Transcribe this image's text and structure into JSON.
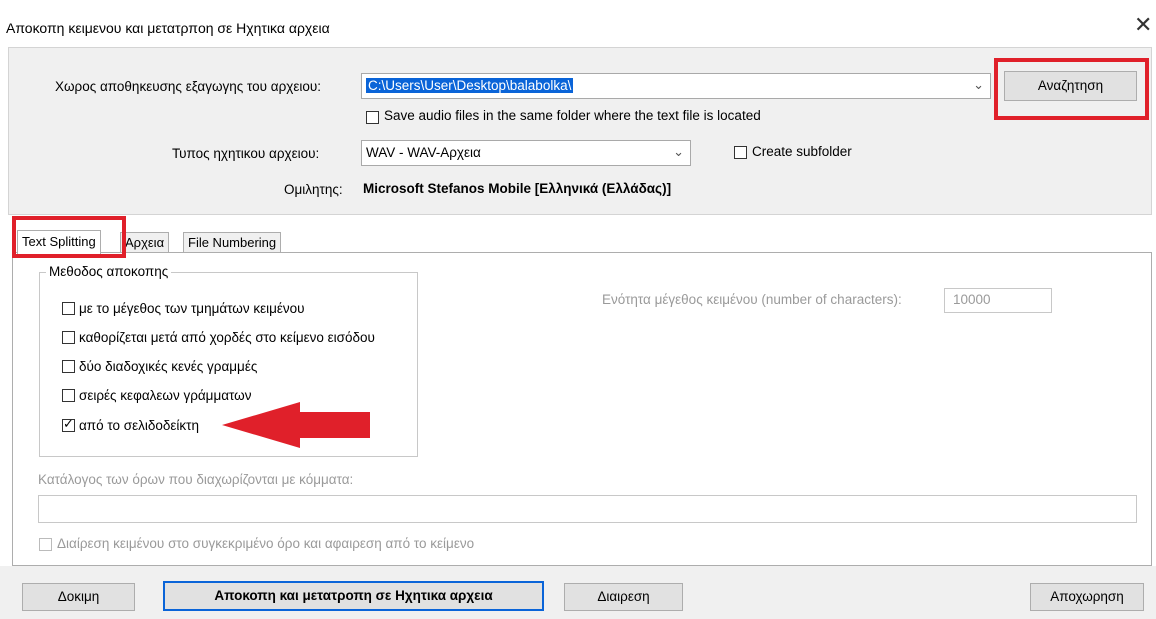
{
  "window": {
    "title": "Αποκοπη κειμενου και μετατρπoη σε Ηχητικα αρχεια",
    "close_glyph": "✕"
  },
  "output": {
    "folder_label": "Χωρος αποθηκευσης εξαγωγης του αρχειου:",
    "folder_value": "C:\\Users\\User\\Desktop\\balabolka\\",
    "browse_label": "Αναζητηση",
    "same_folder_label": "Save audio files in the same folder where the text file is located",
    "same_folder_checked": false,
    "type_label": "Τυπος ηχητικου αρχειου:",
    "type_value": "WAV - WAV-Αρχεια",
    "subfolder_label": "Create subfolder",
    "subfolder_checked": false,
    "speaker_label": "Ομιλητης:",
    "speaker_value": "Microsoft Stefanos Mobile [Ελληνικά (Ελλάδας)]"
  },
  "tabs": [
    {
      "label": "Text Splitting",
      "active": true
    },
    {
      "label": "Αρχεια",
      "active": false
    },
    {
      "label": "File Numbering",
      "active": false
    }
  ],
  "splitting": {
    "group_title": "Μεθοδος αποκοπης",
    "options": [
      {
        "label": "με το μέγεθος των τμημάτων κειμένου",
        "checked": false
      },
      {
        "label": "καθορίζεται μετά από χορδές στο κείμενο εισόδου",
        "checked": false
      },
      {
        "label": "δύο διαδοχικές κενές γραμμές",
        "checked": false
      },
      {
        "label": "σειρές κεφαλεων γράμματων",
        "checked": false
      },
      {
        "label": "από το σελιδοδείκτη",
        "checked": true
      }
    ],
    "chunk_size_label": "Ενότητα μέγεθος κειμένου (number of characters):",
    "chunk_size_value": "10000",
    "terms_label": "Κατάλογος των όρων που διαχωρίζονται με κόμματα:",
    "terms_value": "",
    "split_remove_label": "Διαίρεση κειμένου στο συγκεκριμένο όρο και αφαιρεση από το κείμενο",
    "split_remove_checked": false
  },
  "buttons": {
    "test": "Δοκιμη",
    "split_convert": "Αποκοπη και μετατροπη σε Ηχητικα αρχεια",
    "split": "Διαιρεση",
    "cancel": "Αποχωρηση"
  },
  "colors": {
    "highlight_red": "#e0202a",
    "selection_blue": "#0a64d8",
    "panel_bg": "#f0f0f0"
  },
  "icons": {
    "close": "close-icon",
    "dropdown": "chevron-down-icon",
    "annotation": "red-arrow-annotation"
  }
}
